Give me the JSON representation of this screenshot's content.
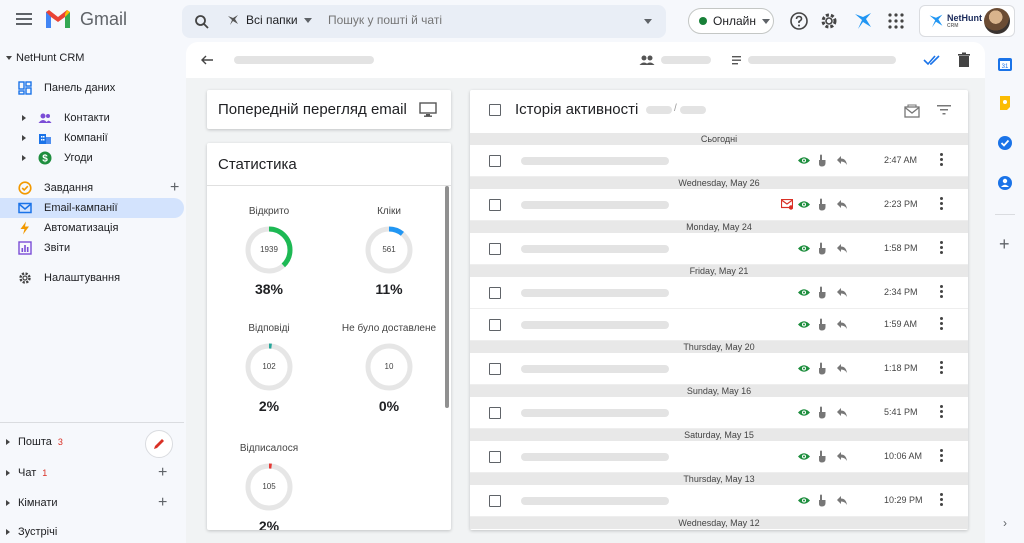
{
  "topbar": {
    "app_name": "Gmail",
    "search": {
      "folder_label": "Всі папки",
      "placeholder": "Пошук у пошті й чаті"
    },
    "status_label": "Онлайн",
    "status_color": "#188038",
    "nethunt_brand": "NetHunt",
    "nethunt_sub": "CRM"
  },
  "sidebar": {
    "crm_title": "NetHunt CRM",
    "dashboard": "Панель даних",
    "contacts": "Контакти",
    "companies": "Компанії",
    "deals": "Угоди",
    "tasks": "Завдання",
    "email_campaigns": "Email-кампанії",
    "automation": "Автоматизація",
    "reports": "Звіти",
    "settings": "Налаштування",
    "mail": "Пошта",
    "mail_count": "3",
    "chat": "Чат",
    "chat_count": "1",
    "rooms": "Кімнати",
    "meetings": "Зустрічі"
  },
  "preview_card": {
    "title": "Попередній перегляд email"
  },
  "stats_card": {
    "title": "Статистика",
    "items": [
      {
        "label": "Відкрито",
        "count": "1939",
        "percent_text": "38%",
        "fraction": 0.38,
        "color": "#1db954"
      },
      {
        "label": "Кліки",
        "count": "561",
        "percent_text": "11%",
        "fraction": 0.11,
        "color": "#2196f3"
      },
      {
        "label": "Відповіді",
        "count": "102",
        "percent_text": "2%",
        "fraction": 0.02,
        "color": "#26a69a"
      },
      {
        "label": "Не було доставлене",
        "count": "10",
        "percent_text": "0%",
        "fraction": 0.0,
        "color": "#e0e0e0"
      },
      {
        "label": "Відписалося",
        "count": "105",
        "percent_text": "2%",
        "fraction": 0.02,
        "color": "#e53935"
      }
    ]
  },
  "history_card": {
    "title": "Історія активності",
    "separator": "/",
    "groups": [
      {
        "date": "Сьогодні",
        "rows": [
          {
            "time": "2:47 AM",
            "bounce": false
          }
        ]
      },
      {
        "date": "Wednesday, May 26",
        "rows": [
          {
            "time": "2:23 PM",
            "bounce": true
          }
        ]
      },
      {
        "date": "Monday, May 24",
        "rows": [
          {
            "time": "1:58 PM",
            "bounce": false
          }
        ]
      },
      {
        "date": "Friday, May 21",
        "rows": [
          {
            "time": "2:34 PM",
            "bounce": false
          },
          {
            "time": "1:59 AM",
            "bounce": false
          }
        ]
      },
      {
        "date": "Thursday, May 20",
        "rows": [
          {
            "time": "1:18 PM",
            "bounce": false
          }
        ]
      },
      {
        "date": "Sunday, May 16",
        "rows": [
          {
            "time": "5:41 PM",
            "bounce": false
          }
        ]
      },
      {
        "date": "Saturday, May 15",
        "rows": [
          {
            "time": "10:06 AM",
            "bounce": false
          }
        ]
      },
      {
        "date": "Thursday, May 13",
        "rows": [
          {
            "time": "10:29 PM",
            "bounce": false
          }
        ]
      },
      {
        "date": "Wednesday, May 12",
        "rows": []
      }
    ]
  },
  "colors": {
    "accent_blue": "#1a73e8",
    "eye_green": "#1e8e3e",
    "bounce_red": "#d93025"
  }
}
